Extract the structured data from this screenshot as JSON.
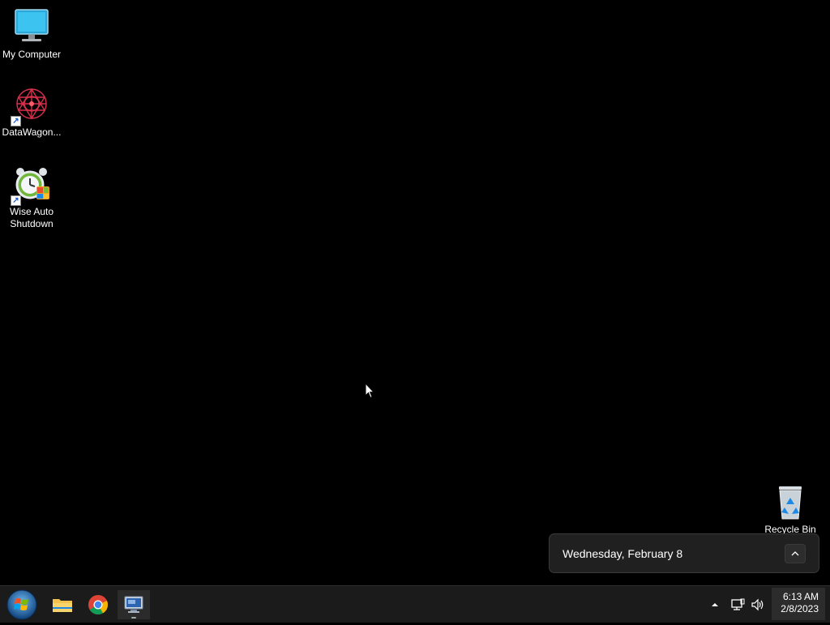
{
  "desktop": {
    "icons": [
      {
        "label": "My Computer",
        "icon": "monitor-icon"
      },
      {
        "label": "DataWagon...",
        "icon": "datawagon-icon"
      },
      {
        "label": "Wise Auto Shutdown",
        "icon": "alarm-clock-icon"
      },
      {
        "label": "Recycle Bin",
        "icon": "recycle-bin-icon"
      }
    ]
  },
  "flyout": {
    "date_text": "Wednesday, February 8",
    "expand_icon": "chevron-up-icon"
  },
  "taskbar": {
    "start_icon": "windows-orb-icon",
    "pinned": [
      {
        "name": "file-explorer",
        "icon": "folder-icon"
      },
      {
        "name": "chrome",
        "icon": "chrome-icon"
      },
      {
        "name": "rdp-app",
        "icon": "remote-desktop-icon"
      }
    ],
    "tray": {
      "overflow_icon": "caret-up-icon",
      "network_icon": "network-icon",
      "volume_icon": "volume-icon"
    },
    "clock": {
      "time": "6:13 AM",
      "date": "2/8/2023"
    }
  },
  "colors": {
    "background": "#000000",
    "taskbar": "#1b1b1b",
    "flyout": "#202020",
    "accent": "#1e88e5"
  }
}
